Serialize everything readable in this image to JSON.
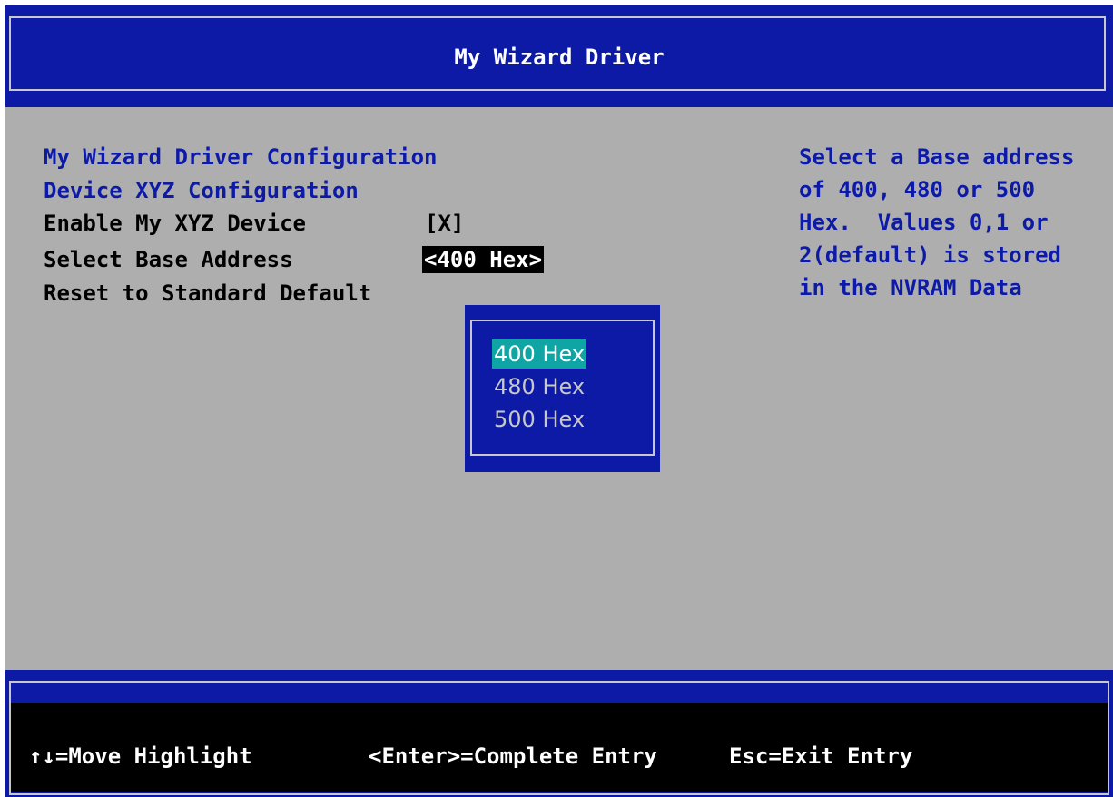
{
  "header": {
    "title": "My Wizard Driver"
  },
  "form": {
    "section_title": "My Wizard Driver Configuration",
    "subsection_title": "Device XYZ Configuration",
    "items": [
      {
        "label": "Enable My XYZ Device",
        "value": "[X]"
      },
      {
        "label": "Select Base Address",
        "value": "<400 Hex>"
      },
      {
        "label": "Reset to Standard Default",
        "value": ""
      }
    ]
  },
  "help": {
    "lines": [
      "Select a Base address",
      "of 400, 480 or 500",
      "Hex.  Values 0,1 or",
      "2(default) is stored",
      "in the NVRAM Data"
    ]
  },
  "popup": {
    "options": [
      "400 Hex",
      "480 Hex",
      "500 Hex"
    ],
    "selected": "400 Hex"
  },
  "footer": {
    "move": "↑↓=Move Highlight",
    "enter": "<Enter>=Complete Entry",
    "esc": "Esc=Exit Entry"
  },
  "colors": {
    "background": "#aeaeae",
    "bios_blue": "#0d1aa6",
    "highlight_cyan": "#10a5a5",
    "footer_black": "#000000"
  }
}
